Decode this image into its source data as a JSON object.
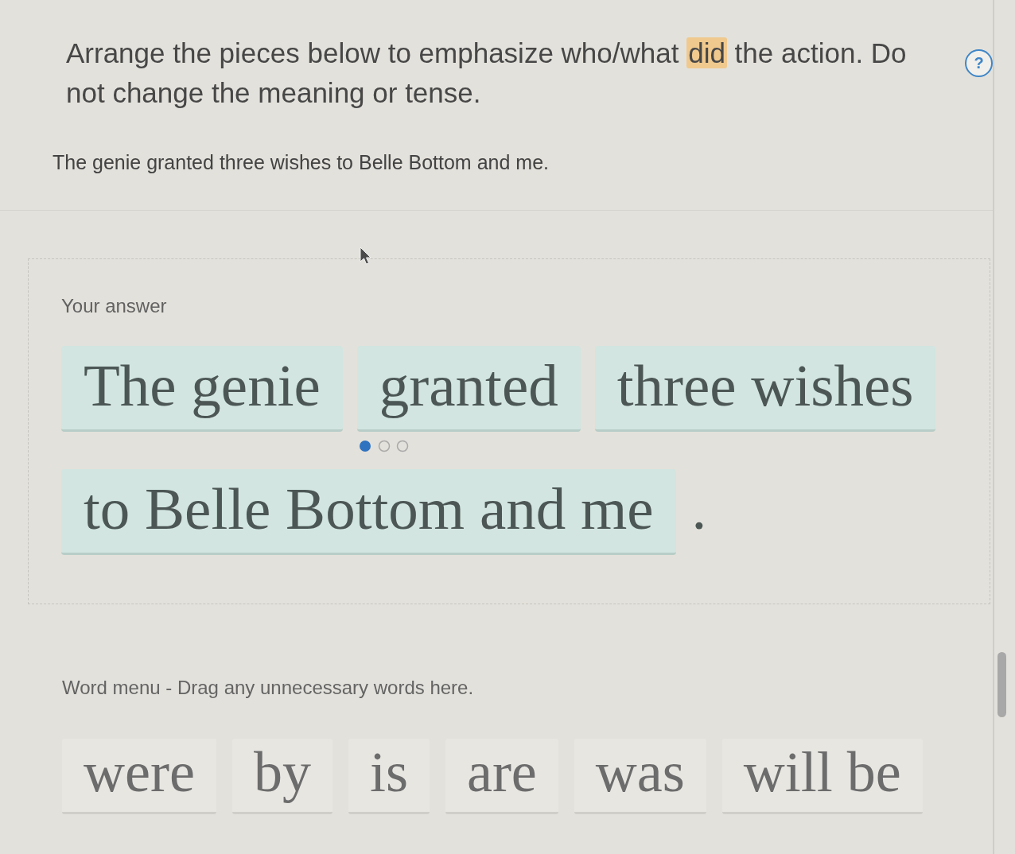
{
  "instructions": {
    "parts": [
      {
        "text": "Arrange the pieces below to emphasize who/what ",
        "highlighted": false
      },
      {
        "text": "did",
        "highlighted": true
      },
      {
        "text": " the action. Do not change the meaning or tense.",
        "highlighted": false
      }
    ]
  },
  "help_button": {
    "label": "?"
  },
  "sentence": "The genie granted three wishes to Belle Bottom and me.",
  "answer": {
    "label": "Your answer",
    "tiles": [
      {
        "text": "The genie",
        "dots": false
      },
      {
        "text": "granted",
        "dots": true
      },
      {
        "text": "three wishes",
        "dots": false
      },
      {
        "text": "to Belle Bottom and me",
        "dots": false
      }
    ],
    "ending": "."
  },
  "word_menu": {
    "label": "Word menu - Drag any unnecessary words here.",
    "words": [
      {
        "text": "were"
      },
      {
        "text": "by"
      },
      {
        "text": "is"
      },
      {
        "text": "are"
      },
      {
        "text": "was"
      },
      {
        "text": "will be"
      }
    ]
  }
}
